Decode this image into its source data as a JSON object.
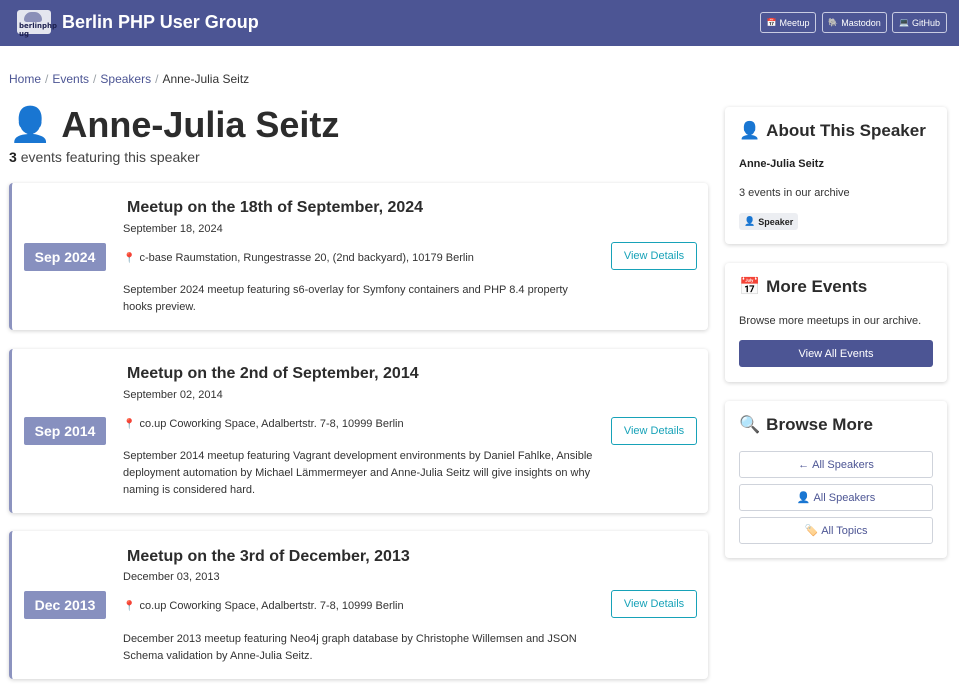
{
  "header": {
    "logo_text": "berlinphp ug",
    "title": "Berlin PHP User Group",
    "links": [
      {
        "icon": "calendar-icon",
        "glyph": "📅",
        "label": "Meetup"
      },
      {
        "icon": "mastodon-icon",
        "glyph": "🐘",
        "label": "Mastodon"
      },
      {
        "icon": "laptop-icon",
        "glyph": "💻",
        "label": "GitHub"
      }
    ]
  },
  "breadcrumb": {
    "items": [
      "Home",
      "Events",
      "Speakers"
    ],
    "separator": "/",
    "current": "Anne-Julia Seitz"
  },
  "speaker": {
    "icon": "👤",
    "name": "Anne-Julia Seitz",
    "event_count": "3",
    "event_count_suffix": "events featuring this speaker"
  },
  "events": [
    {
      "badge": "Sep 2024",
      "title": "Meetup on the 18th of September, 2024",
      "date": "September 18, 2024",
      "location": "c-base Raumstation, Rungestrasse 20, (2nd backyard), 10179 Berlin",
      "description": "September 2024 meetup featuring s6-overlay for Symfony containers and PHP 8.4 property hooks preview.",
      "button": "View Details"
    },
    {
      "badge": "Sep 2014",
      "title": "Meetup on the 2nd of September, 2014",
      "date": "September 02, 2014",
      "location": "co.up Coworking Space, Adalbertstr. 7-8, 10999 Berlin",
      "description": "September 2014 meetup featuring Vagrant development environments by Daniel Fahlke, Ansible deployment automation by Michael Lämmermeyer and Anne-Julia Seitz will give insights on why naming is considered hard.",
      "button": "View Details"
    },
    {
      "badge": "Dec 2013",
      "title": "Meetup on the 3rd of December, 2013",
      "date": "December 03, 2013",
      "location": "co.up Coworking Space, Adalbertstr. 7-8, 10999 Berlin",
      "description": "December 2013 meetup featuring Neo4j graph database by Christophe Willemsen and JSON Schema validation by Anne-Julia Seitz.",
      "button": "View Details"
    }
  ],
  "sidebar": {
    "about": {
      "icon": "👤",
      "title": "About This Speaker",
      "name": "Anne-Julia Seitz",
      "count_text": "3 events in our archive",
      "badge_icon": "👤",
      "badge": "Speaker"
    },
    "more_events": {
      "icon": "📅",
      "title": "More Events",
      "text": "Browse more meetups in our archive.",
      "button": "View All Events"
    },
    "browse_more": {
      "icon": "🔍",
      "title": "Browse More",
      "buttons": [
        {
          "glyph": "←",
          "label": "All Speakers"
        },
        {
          "glyph": "👤",
          "label": "All Speakers"
        },
        {
          "glyph": "🏷️",
          "label": "All Topics"
        }
      ]
    }
  },
  "colors": {
    "navbar": "#4c5594",
    "badge": "#8790bf",
    "details_button": "#17a2b8",
    "link": "#4c5594"
  }
}
